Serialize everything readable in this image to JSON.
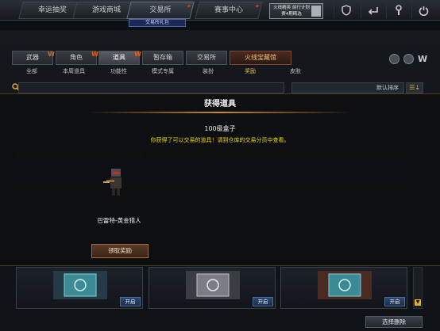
{
  "top_nav": {
    "tabs": [
      {
        "label": "幸运抽奖"
      },
      {
        "label": "游戏商城"
      },
      {
        "label": "交易所"
      },
      {
        "label": "赛事中心"
      }
    ],
    "promo_badge": "火线精英 前行计划 赛4期精选",
    "tool_icons": [
      "shield-icon",
      "return-icon",
      "wrench-icon",
      "power-icon"
    ]
  },
  "subtab_label": "交易所礼包",
  "category_tabs": [
    "武器",
    "角色",
    "道具",
    "暂存箱",
    "交易所",
    "火线宝藏馆"
  ],
  "filter_tabs": [
    "全部",
    "本周道具",
    "功能性",
    "模式专属",
    "装扮",
    "奖励",
    "皮肤"
  ],
  "sort": {
    "label": "默认排序"
  },
  "modal": {
    "title": "获得道具",
    "item_name": "100级盒子",
    "message": "你获得了可以交易的道具！请到仓库的交易分页中查看。",
    "character_name": "巴雷特-黄金猎人",
    "claim_button": "领取奖励"
  },
  "item_cards": [
    {
      "open_label": "开启"
    },
    {
      "open_label": "开启"
    },
    {
      "open_label": "开启"
    }
  ],
  "select_delete_label": "选择删除",
  "colors": {
    "accent_gold": "#e8c040",
    "message_yellow": "#f0d800",
    "fire_orange": "#e06020"
  }
}
